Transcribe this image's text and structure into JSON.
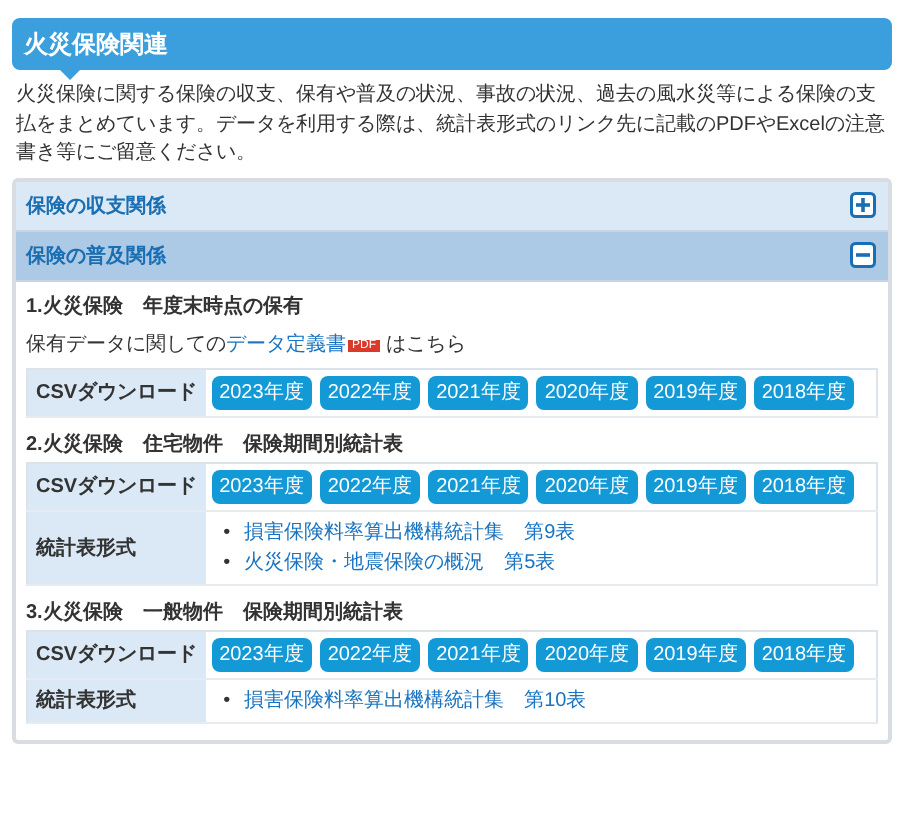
{
  "header": {
    "title": "火災保険関連"
  },
  "intro": "火災保険に関する保険の収支、保有や普及の状況、事故の状況、過去の風水災等による保険の支払をまとめています。データを利用する際は、統計表形式のリンク先に記載のPDFやExcelの注意書き等にご留意ください。",
  "accordion": [
    {
      "title": "保険の収支関係",
      "expanded": false
    },
    {
      "title": "保険の普及関係",
      "expanded": true,
      "sections": [
        {
          "title": "1.火災保険　年度末時点の保有",
          "note": {
            "before": "保有データに関しての",
            "link": "データ定義書",
            "badge": "PDF",
            "after": "はこちら"
          },
          "rows": [
            {
              "kind": "csv",
              "label": "CSVダウンロード",
              "buttons": [
                "2023年度",
                "2022年度",
                "2021年度",
                "2020年度",
                "2019年度",
                "2018年度"
              ]
            }
          ]
        },
        {
          "title": "2.火災保険　住宅物件　保険期間別統計表",
          "rows": [
            {
              "kind": "csv",
              "label": "CSVダウンロード",
              "buttons": [
                "2023年度",
                "2022年度",
                "2021年度",
                "2020年度",
                "2019年度",
                "2018年度"
              ]
            },
            {
              "kind": "links",
              "label": "統計表形式",
              "marker": "•",
              "links": [
                "損害保険料率算出機構統計集　第9表",
                "火災保険・地震保険の概況　第5表"
              ]
            }
          ]
        },
        {
          "title": "3.火災保険　一般物件　保険期間別統計表",
          "rows": [
            {
              "kind": "csv",
              "label": "CSVダウンロード",
              "buttons": [
                "2023年度",
                "2022年度",
                "2021年度",
                "2020年度",
                "2019年度",
                "2018年度"
              ]
            },
            {
              "kind": "links",
              "label": "統計表形式",
              "marker": "•",
              "links": [
                "損害保険料率算出機構統計集　第10表"
              ]
            }
          ]
        }
      ]
    }
  ]
}
